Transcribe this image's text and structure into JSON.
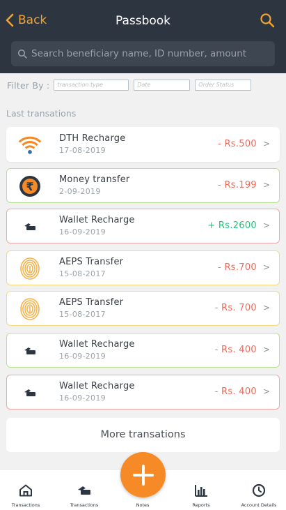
{
  "header": {
    "back_label": "Back",
    "title": "Passbook",
    "search_placeholder": "Search beneficiary name, ID number, amount"
  },
  "filter": {
    "label": "Filter By :",
    "transaction_type_placeholder": "transaction type",
    "date_placeholder": "Date",
    "order_status_placeholder": "Order Status"
  },
  "section_title": "Last transations",
  "transactions": [
    {
      "name": "DTH Recharge",
      "date": "17-08-2019",
      "amount": "- Rs.500",
      "icon": "wifi-icon",
      "status": "plain"
    },
    {
      "name": "Money transfer",
      "date": "2-09-2019",
      "amount": "- Rs.199",
      "icon": "rupee-coin-icon",
      "status": "green"
    },
    {
      "name": "Wallet Recharge",
      "date": "16-09-2019",
      "amount": "+ Rs.2600",
      "icon": "wallet-icon",
      "status": "red"
    },
    {
      "name": "AEPS Transfer",
      "date": "15-08-2017",
      "amount": "- Rs.700",
      "icon": "fingerprint-icon",
      "status": "yellow"
    },
    {
      "name": "AEPS Transfer",
      "date": "15-08-2017",
      "amount": "- Rs. 700",
      "icon": "fingerprint-icon",
      "status": "yellow"
    },
    {
      "name": "Wallet Recharge",
      "date": "16-09-2019",
      "amount": "- Rs. 400",
      "icon": "wallet-icon",
      "status": "green"
    },
    {
      "name": "Wallet Recharge",
      "date": "16-09-2019",
      "amount": "- Rs. 400",
      "icon": "wallet-icon",
      "status": "red"
    }
  ],
  "chevron": ">",
  "more_label": "More transations",
  "nav": [
    {
      "label": "Transactions",
      "icon": "home-icon"
    },
    {
      "label": "Transactions",
      "icon": "wallet-icon"
    },
    {
      "label": "Notes",
      "icon": "plus-icon"
    },
    {
      "label": "Reports",
      "icon": "bar-chart-icon"
    },
    {
      "label": "Account Details",
      "icon": "clock-icon"
    }
  ],
  "colors": {
    "header_bg": "#2d3640",
    "accent_orange": "#f2a431",
    "fab_orange": "#f58a26",
    "debit_red": "#ea6a5c",
    "credit_green": "#27c07d",
    "border_green": "#b7e28f",
    "border_red": "#f2a6a6",
    "border_yellow": "#f7db77"
  }
}
